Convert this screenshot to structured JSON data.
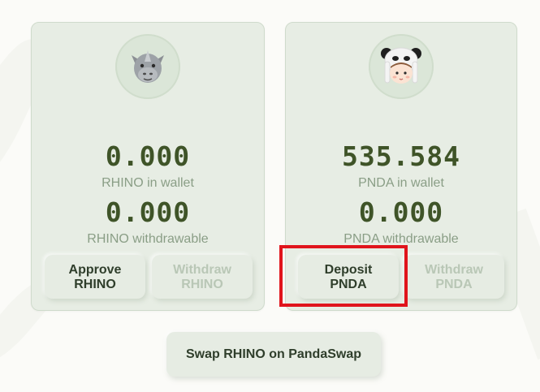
{
  "rhino": {
    "avatar_icon": "rhino-face-icon",
    "wallet_amount": "0.000",
    "wallet_caption": "RHINO in wallet",
    "withdrawable_amount": "0.000",
    "withdrawable_caption": "RHINO withdrawable",
    "approve_label": "Approve\nRHINO",
    "withdraw_label": "Withdraw\nRHINO"
  },
  "pnda": {
    "avatar_icon": "panda-hat-face-icon",
    "wallet_amount": "535.584",
    "wallet_caption": "PNDA in wallet",
    "withdrawable_amount": "0.000",
    "withdrawable_caption": "PNDA withdrawable",
    "deposit_label": "Deposit\nPNDA",
    "withdraw_label": "Withdraw\nPNDA"
  },
  "swap_label": "Swap RHINO on PandaSwap",
  "colors": {
    "amount": "#3f5428",
    "caption": "#8a9e86",
    "button_text": "#2f3e2b",
    "disabled_text": "#b9c7b6",
    "card": "#e7ede4",
    "highlight": "#e0141c"
  }
}
